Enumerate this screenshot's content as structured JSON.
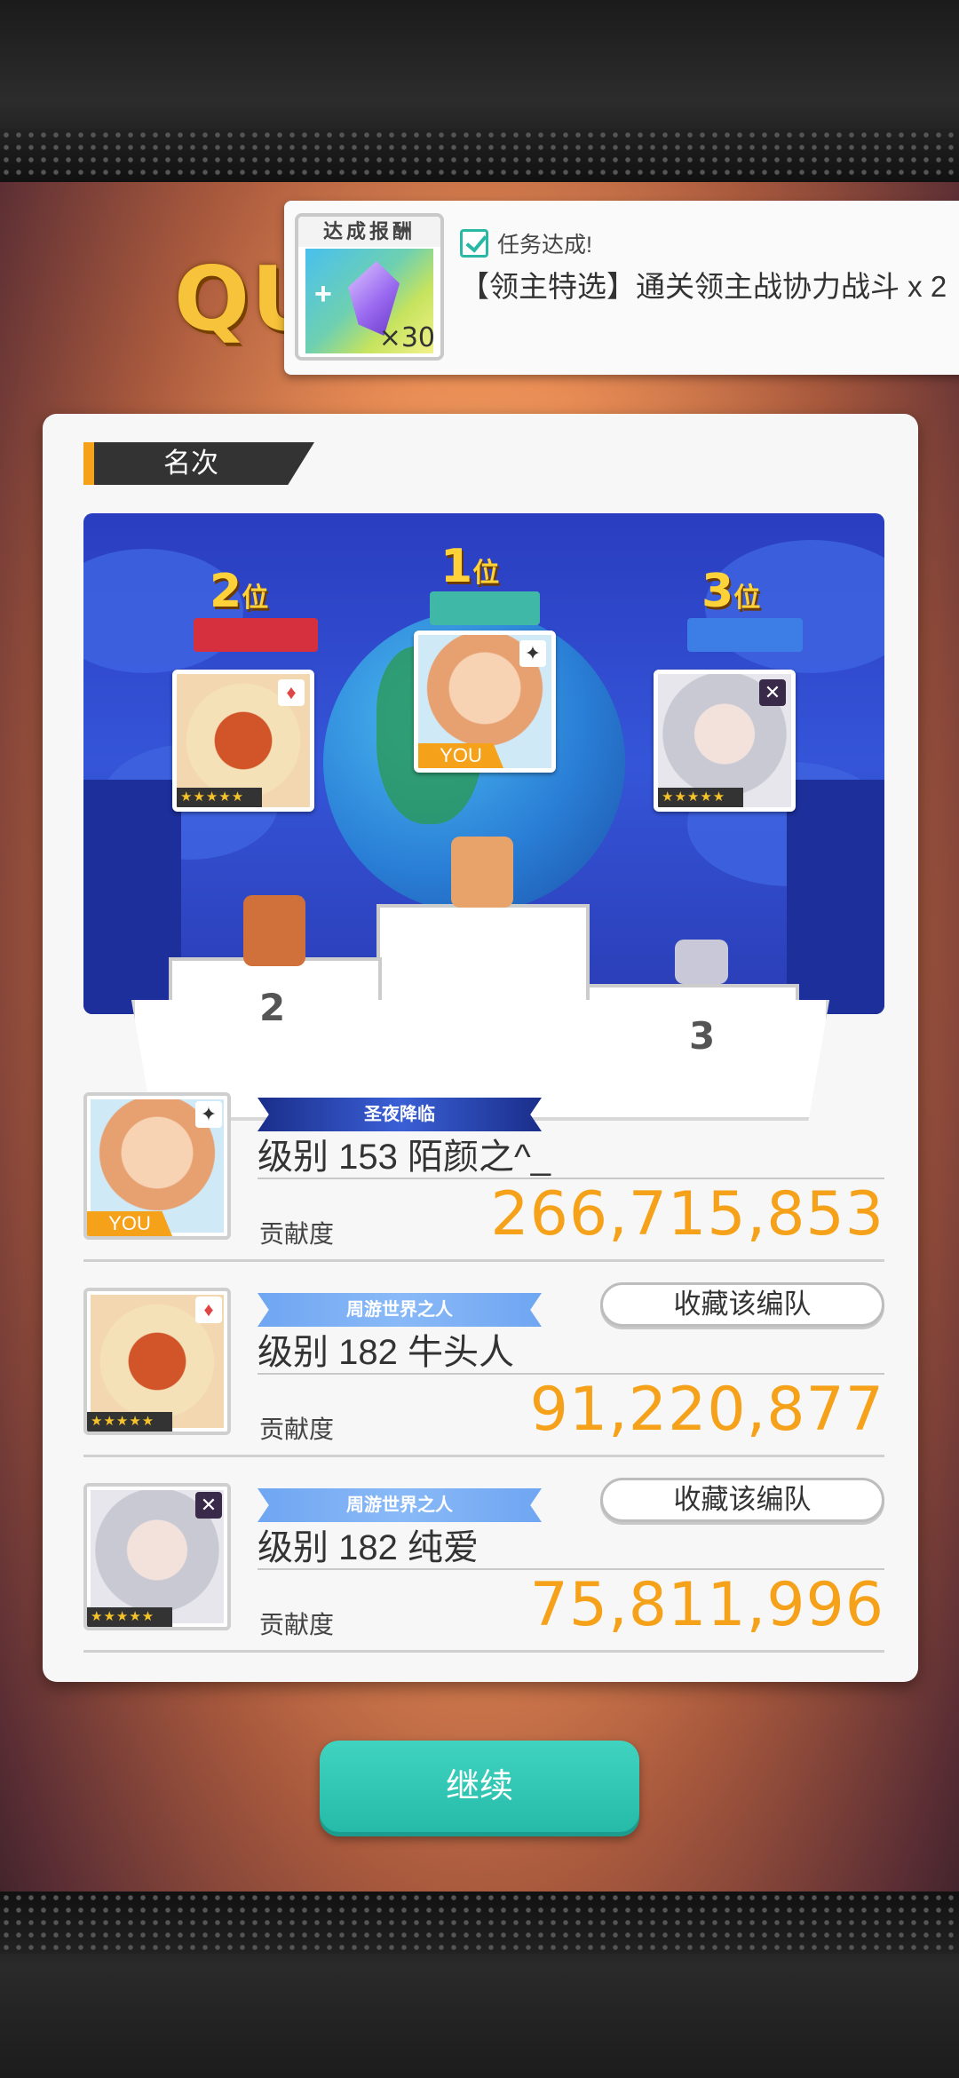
{
  "background": {
    "title_fragment": "QU"
  },
  "toast": {
    "reward_header": "达成报酬",
    "reward_quantity": "×30",
    "status": "任务达成!",
    "mission_text": "【领主特选】通关领主战协力战斗 x 2"
  },
  "card": {
    "section_title": "名次",
    "podium": {
      "first_label": "1",
      "first_suffix": "位",
      "second_label": "2",
      "second_suffix": "位",
      "third_label": "3",
      "third_suffix": "位",
      "you_tag": "YOU",
      "stars": "★★★★★",
      "second_step": "2",
      "third_step": "3"
    },
    "rows": [
      {
        "badge": "圣夜降临",
        "name": "级别 153 陌颜之^_",
        "score_label": "贡献度",
        "score": "266,715,853",
        "you_tag": "YOU"
      },
      {
        "badge": "周游世界之人",
        "name": "级别 182 牛头人",
        "score_label": "贡献度",
        "score": "91,220,877",
        "favorite_button": "收藏该编队",
        "stars": "★★★★★"
      },
      {
        "badge": "周游世界之人",
        "name": "级别 182 纯爱",
        "score_label": "贡献度",
        "score": "75,811,996",
        "favorite_button": "收藏该编队",
        "stars": "★★★★★"
      }
    ]
  },
  "continue_button": "继续",
  "colors": {
    "accent_orange": "#f5a21a",
    "button_teal": "#2ec4b2",
    "header_dark": "#333333"
  }
}
